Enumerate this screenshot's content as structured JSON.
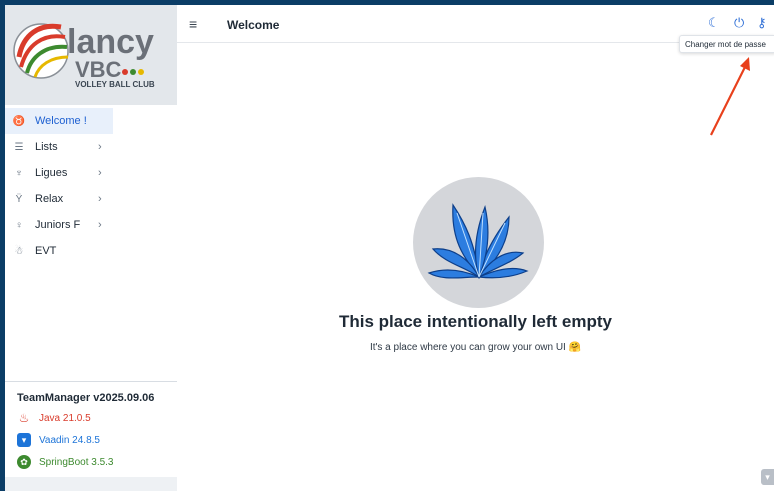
{
  "header": {
    "title": "Welcome",
    "tooltip": "Changer mot de passe"
  },
  "logo": {
    "name_line1": "lancy",
    "name_line2": "VBC",
    "tagline": "VOLLEY BALL CLUB"
  },
  "nav": {
    "items": [
      {
        "label": "Welcome !",
        "icon": "cheers-icon",
        "active": true
      },
      {
        "label": "Lists",
        "icon": "list-icon",
        "has_children": true
      },
      {
        "label": "Ligues",
        "icon": "trophy-icon",
        "has_children": true
      },
      {
        "label": "Relax",
        "icon": "cocktail-icon",
        "has_children": true
      },
      {
        "label": "Juniors F",
        "icon": "female-icon",
        "has_children": true
      },
      {
        "label": "EVT",
        "icon": "person-icon",
        "has_children": false
      }
    ]
  },
  "footer": {
    "app_version": "TeamManager v2025.09.06",
    "java": "Java 21.0.5",
    "vaadin": "Vaadin 24.8.5",
    "spring": "SpringBoot 3.5.3"
  },
  "main": {
    "empty_title": "This place intentionally left empty",
    "empty_subtitle": "It's a place where you can grow your own UI 🤗"
  },
  "colors": {
    "accent": "#1c5fd1",
    "java": "#d93b2b",
    "vaadin": "#1d74d8",
    "spring": "#3d8a2f",
    "annotation_arrow": "#e8401c"
  }
}
